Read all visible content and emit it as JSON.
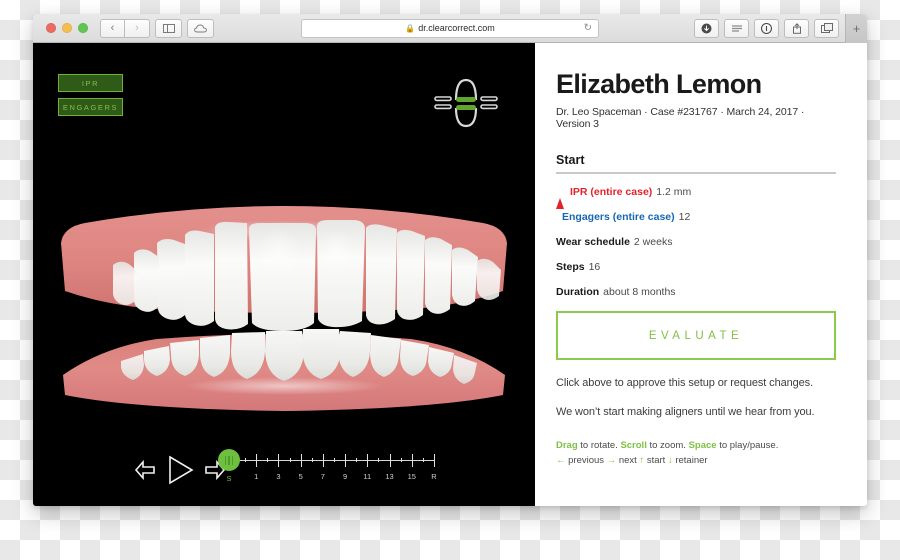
{
  "browser": {
    "url": "dr.clearcorrect.com",
    "lock_icon": "lock-icon",
    "reload_icon": "reload-icon",
    "back_label": "‹",
    "forward_label": "›",
    "sidebar_icon": "sidebar-icon",
    "cloud_icon": "icloud-tabs-icon",
    "downloads_icon": "downloads-icon",
    "reader_icon": "reader-icon",
    "privacy_icon": "privacy-report-icon",
    "share_icon": "share-icon",
    "tabs_icon": "tab-overview-icon",
    "newtab_label": "+"
  },
  "viewer": {
    "layer_toggles": [
      {
        "label": "IPR",
        "name": "toggle-ipr"
      },
      {
        "label": "ENGAGERS",
        "name": "toggle-engagers"
      }
    ],
    "arch_icon": "arch-selector-icon",
    "controls": {
      "previous_icon": "previous-step-icon",
      "play_icon": "play-icon",
      "next_icon": "next-step-icon",
      "playhead_label": "S"
    },
    "timeline": {
      "labels": [
        "S",
        "1",
        "3",
        "5",
        "7",
        "9",
        "11",
        "13",
        "15",
        "R"
      ],
      "major_count": 10,
      "minor_count": 9
    }
  },
  "info": {
    "patient_name": "Elizabeth Lemon",
    "case_meta": "Dr. Leo Spaceman · Case #231767 · March 24, 2017 · Version 3",
    "section_title": "Start",
    "specs": [
      {
        "label": "IPR (entire case)",
        "value": "1.2 mm",
        "marker": "red-triangle-icon"
      },
      {
        "label": "Engagers (entire case)",
        "value": "12",
        "marker": "blue-square-icon"
      },
      {
        "label": "Wear schedule",
        "value": "2 weeks",
        "marker": "none"
      },
      {
        "label": "Steps",
        "value": "16",
        "marker": "none"
      },
      {
        "label": "Duration",
        "value": "about 8 months",
        "marker": "none"
      }
    ],
    "evaluate_label": "EVALUATE",
    "note_1": "Click above to approve this setup or request changes.",
    "note_2": "We won’t start making aligners until we hear from you.",
    "help": {
      "drag": "Drag",
      "drag_rest": " to rotate. ",
      "scroll": "Scroll",
      "scroll_rest": " to zoom. ",
      "space": "Space",
      "space_rest": " to play/pause.",
      "prev_arrow": "←",
      "prev_text": " previous ",
      "next_arrow": "→",
      "next_text": " next ",
      "start_arrow": "↑",
      "start_text": " start ",
      "retainer_arrow": "↓",
      "retainer_text": " retainer"
    }
  },
  "colors": {
    "accent_green": "#7fc143",
    "ipr_red": "#e4222b",
    "engager_blue": "#1767b3",
    "gum_pink": "#e08a86",
    "tooth_white": "#f2f2f0"
  }
}
